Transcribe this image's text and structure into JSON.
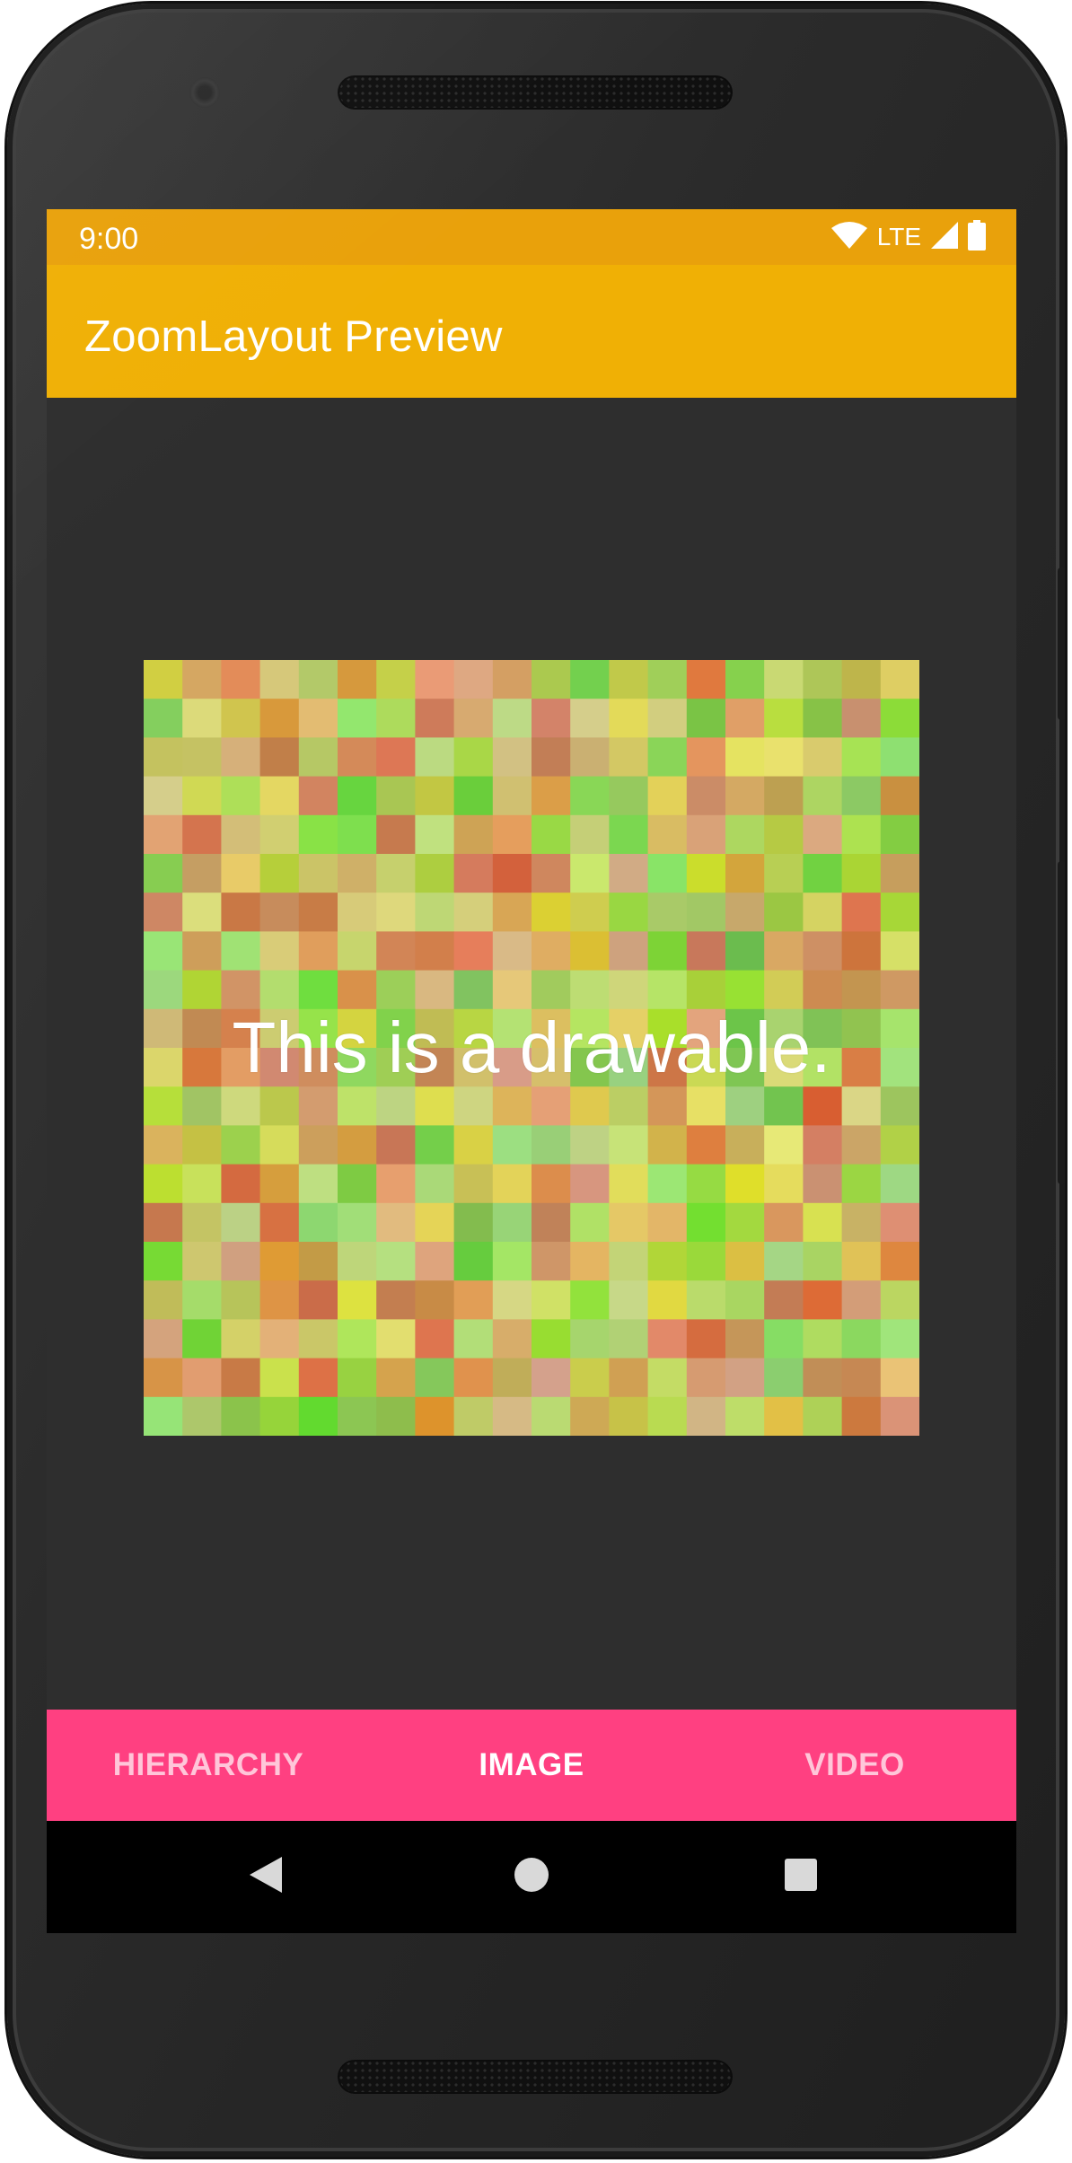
{
  "status_bar": {
    "time": "9:00",
    "network": "LTE",
    "icons": [
      "wifi-icon",
      "signal-icon",
      "battery-icon"
    ]
  },
  "app_bar": {
    "title": "ZoomLayout Preview",
    "color": "#f0b005"
  },
  "content": {
    "drawable_text": "This is a drawable."
  },
  "bottom_nav": {
    "color": "#ff4081",
    "selected": "IMAGE",
    "items": [
      {
        "label": "HIERARCHY"
      },
      {
        "label": "IMAGE"
      },
      {
        "label": "VIDEO"
      }
    ]
  },
  "system_nav": {
    "buttons": [
      "back-icon",
      "home-icon",
      "recents-icon"
    ]
  }
}
